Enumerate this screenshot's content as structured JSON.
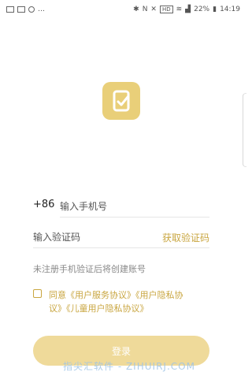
{
  "status_bar": {
    "battery": "22%",
    "time": "14:19",
    "hd": "HD",
    "left_icons": [
      "gallery-icon",
      "message-icon",
      "settings-icon",
      "more-icon"
    ],
    "right_icons": [
      "bluetooth-icon",
      "nfc-icon",
      "mute-icon",
      "hd-icon",
      "wifi-icon",
      "signal-icon",
      "battery-icon"
    ]
  },
  "logo": {
    "icon": "app-logo-icon",
    "color": "#e9cf79"
  },
  "phone": {
    "country_code": "+86",
    "placeholder": "输入手机号"
  },
  "code": {
    "placeholder": "输入验证码",
    "get_code_label": "获取验证码"
  },
  "hint": "未注册手机验证后将创建账号",
  "agreement": {
    "prefix": "同意",
    "service": "《用户服务协议》",
    "privacy": "《用户隐私协",
    "privacy_tail": "议》",
    "children": "《儿童用户隐私协议》"
  },
  "login_button": "登录",
  "watermark": "指尖汇软件 - ZIHUIRJ.COM",
  "colors": {
    "accent": "#c9a640",
    "button": "#efda9a"
  }
}
